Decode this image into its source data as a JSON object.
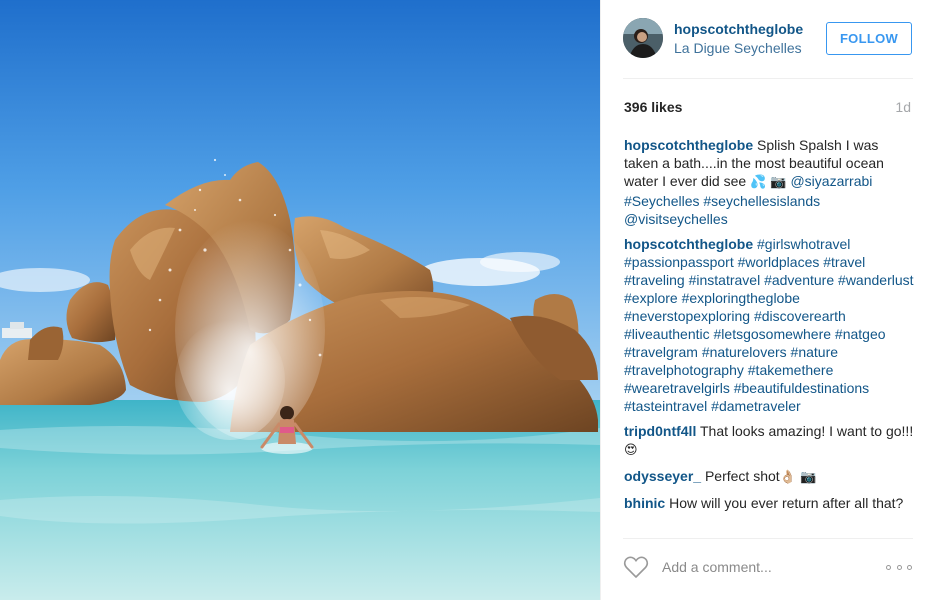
{
  "post": {
    "photo_alt": "",
    "author": {
      "username": "hopscotchtheglobe",
      "location": "La Digue Seychelles"
    },
    "follow_label": "FOLLOW",
    "likes_text": "396 likes",
    "time_text": "1d",
    "comments": [
      {
        "author": "hopscotchtheglobe",
        "text_before": "Splish Spalsh I was taken a bath....in the most beautiful ocean water I ever did see ",
        "emoji": "💦 📷",
        "tags": [
          "@siyazarrabi",
          "#Seychelles",
          "#seychellesislands",
          "@visitseychelles"
        ]
      },
      {
        "author": "hopscotchtheglobe",
        "tags": [
          "#girlswhotravel",
          "#passionpassport",
          "#worldplaces",
          "#travel",
          "#traveling",
          "#instatravel",
          "#adventure",
          "#wanderlust",
          "#explore",
          "#exploringtheglobe",
          "#neverstopexploring",
          "#discoverearth",
          "#liveauthentic",
          "#letsgosomewhere",
          "#natgeo",
          "#travelgram",
          "#naturelovers",
          "#nature",
          "#travelphotography",
          "#takemethere",
          "#wearetravelgirls",
          "#beautifuldestinations",
          "#tasteintravel",
          "#dametraveler"
        ]
      },
      {
        "author": "tripd0ntf4ll",
        "text": "That looks amazing! I want to go!!! ",
        "emoji": "😍"
      },
      {
        "author": "odysseyer_",
        "text": "Perfect shot",
        "emoji": "👌🏼 📷"
      },
      {
        "author": "bhinic",
        "text": "How will you ever return after all that?"
      }
    ],
    "add_comment_placeholder": "Add a comment...",
    "icons": {
      "like": "heart-outline-icon",
      "more": "more-options-icon"
    },
    "colors": {
      "link": "#125688",
      "location": "#3f729b",
      "follow": "#3897f0",
      "muted": "#a5a7aa"
    }
  }
}
